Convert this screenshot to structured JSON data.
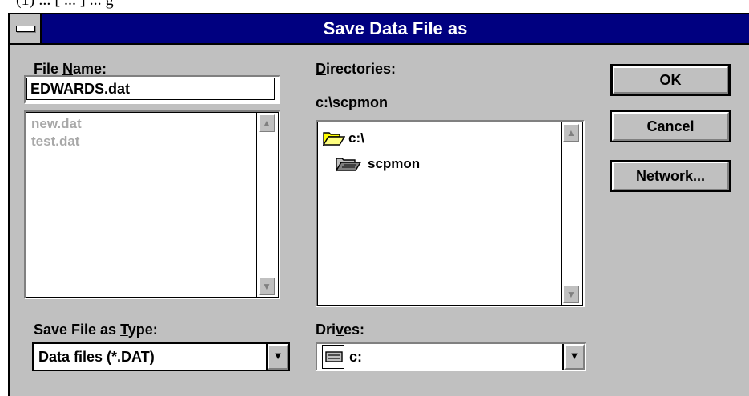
{
  "page_fragment": "(1)  ...  [ ... ]  ... g",
  "window": {
    "title": "Save Data File as"
  },
  "file_name": {
    "label_pre": "File ",
    "label_key": "N",
    "label_post": "ame:",
    "value": "EDWARDS.dat",
    "files": [
      "new.dat",
      "test.dat"
    ]
  },
  "directories": {
    "label_key": "D",
    "label_post": "irectories:",
    "current_path": "c:\\scpmon",
    "items": [
      {
        "name": "c:\\",
        "icon": "open-folder-icon"
      },
      {
        "name": "scpmon",
        "icon": "open-folder-icon"
      }
    ]
  },
  "save_type": {
    "label_pre": "Save File as ",
    "label_key": "T",
    "label_post": "ype:",
    "selected": "Data files   (*.DAT)"
  },
  "drives": {
    "label_pre": "Dri",
    "label_key": "v",
    "label_post": "es:",
    "selected": "c:",
    "icon": "hard-drive-icon"
  },
  "buttons": {
    "ok": "OK",
    "cancel": "Cancel",
    "network": "Network..."
  },
  "icons": {
    "scroll_up": "scroll-up-arrow-icon",
    "scroll_down": "scroll-down-arrow-icon",
    "dropdown": "dropdown-arrow-icon",
    "system_menu": "system-menu-icon"
  },
  "colors": {
    "titlebar": "#000080",
    "face": "#c0c0c0",
    "disabled_text": "#a8a8a8"
  }
}
